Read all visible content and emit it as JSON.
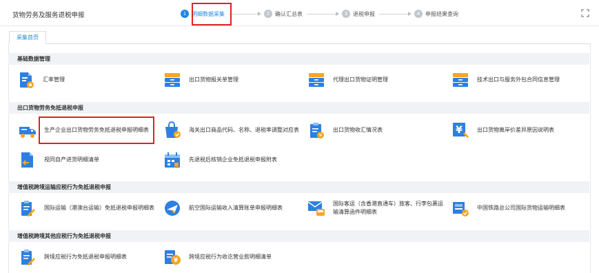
{
  "app": {
    "title": "货物劳务及服务退税申报"
  },
  "steps": [
    {
      "num": "1",
      "label": "明细数据采集",
      "active": true
    },
    {
      "num": "2",
      "label": "确认汇总表",
      "active": false
    },
    {
      "num": "3",
      "label": "退税申报",
      "active": false
    },
    {
      "num": "4",
      "label": "申报结果查询",
      "active": false
    }
  ],
  "tabs": [
    {
      "label": "采集首页"
    }
  ],
  "sections": [
    {
      "title": "基础数据管理",
      "items": [
        {
          "label": "汇率管理",
          "icon": "doc-gear-icon"
        },
        {
          "label": "出口货物报关单管理",
          "icon": "cabinet-icon"
        },
        {
          "label": "代理出口货物证明管理",
          "icon": "cabinet-icon"
        },
        {
          "label": "技术出口与服务外包合同信息管理",
          "icon": "cabinet-icon"
        }
      ]
    },
    {
      "title": "出口货物劳务免抵退税申报",
      "items": [
        {
          "label": "生产企业出口货物劳务免抵退税申报明细表",
          "icon": "truck-icon"
        },
        {
          "label": "海关出口商品代码、名称、退税率调整对应表",
          "icon": "bag-check-icon"
        },
        {
          "label": "出口货物收汇情况表",
          "icon": "clipboard-yen-icon"
        },
        {
          "label": "出口货物离岸价差异原因说明表",
          "icon": "yen-doc-icon"
        },
        {
          "label": "视同自产进货明细清单",
          "icon": "doc-arrow-icon"
        },
        {
          "label": "先退税后核销企业免抵退税申报附表",
          "icon": "calendar-icon"
        }
      ]
    },
    {
      "title": "增值税跨境运输应税行为免抵退税申报",
      "items": [
        {
          "label": "国际运输（港澳台运输）免抵退税申报明细表",
          "icon": "doc-pen-icon"
        },
        {
          "label": "航空国际运输收入清算账单申报明细表",
          "icon": "plane-icon"
        },
        {
          "label": "国际客运（含香港直通车）旅客、行李包裹运输清算函件明细表",
          "icon": "mail-bus-icon"
        },
        {
          "label": "中国铁路总公司国际货物运输明细表",
          "icon": "rail-cargo-icon"
        }
      ]
    },
    {
      "title": "增值税跨境其他应税行为免抵退税申报",
      "items": [
        {
          "label": "跨境应税行为免抵退税申报明细表",
          "icon": "doc-pen-icon"
        },
        {
          "label": "跨境应税行为收讫营业款明细清单",
          "icon": "doc-yen-icon"
        }
      ]
    }
  ],
  "colors": {
    "accent": "#1e88e5",
    "highlight": "#e02020",
    "icon_blue": "#2f7fe0",
    "icon_orange": "#f5a623"
  }
}
